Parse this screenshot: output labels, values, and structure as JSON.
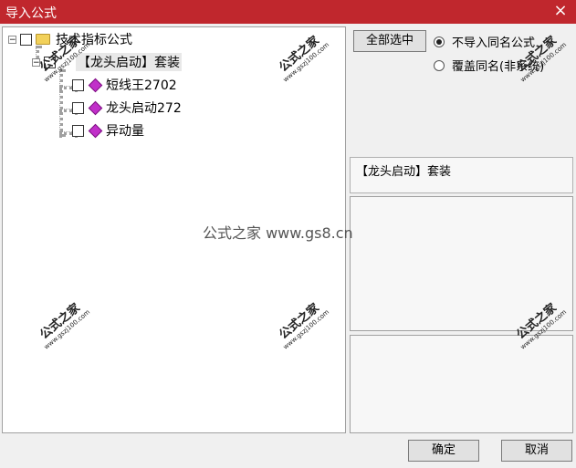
{
  "window": {
    "title": "导入公式",
    "close_glyph": "×"
  },
  "tree": {
    "root_label": "技术指标公式",
    "suite_label": "【龙头启动】套装",
    "items": [
      {
        "label": "短线王2702"
      },
      {
        "label": "龙头启动272"
      },
      {
        "label": "异动量"
      }
    ],
    "expander_glyph": "−"
  },
  "buttons": {
    "select_all": "全部选中",
    "ok": "确定",
    "cancel": "取消"
  },
  "options": {
    "no_import": "不导入同名公式",
    "overwrite": "覆盖同名(非系统)",
    "selected": "no_import"
  },
  "info": {
    "selected_name": "【龙头启动】套装"
  },
  "watermark": {
    "center": "公式之家 www.gs8.cn",
    "stamp_big": "公式之家",
    "stamp_small": "www.gszj100.com"
  },
  "colors": {
    "title_bar": "#c0272d",
    "item_icon": "#c12fc9",
    "folder": "#f2d15a"
  }
}
